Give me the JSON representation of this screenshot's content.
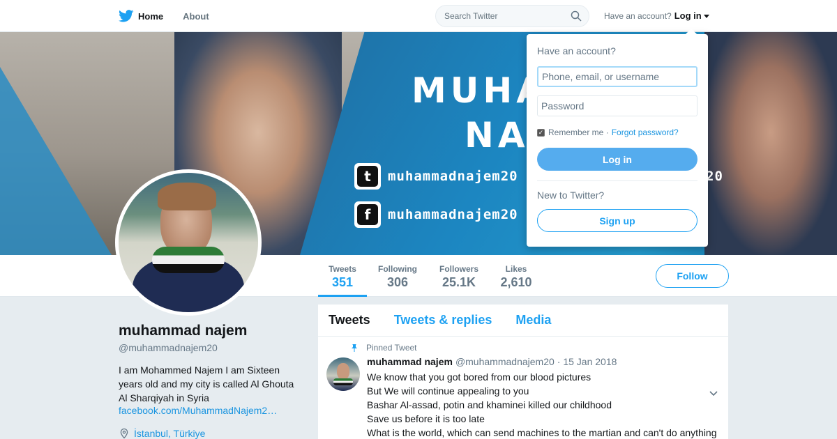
{
  "nav": {
    "home_label": "Home",
    "about_label": "About",
    "search_placeholder": "Search Twitter",
    "account_prompt": "Have an account?",
    "login_label": "Log in"
  },
  "banner": {
    "name_line1": "MUHA",
    "name_line2": "NAJ",
    "twitter_handle": "muhammadnajem20",
    "facebook_handle": "muhammadnajem20",
    "twitter_glyph": "t",
    "facebook_glyph": "f",
    "tail": "20"
  },
  "stats": [
    {
      "label": "Tweets",
      "value": "351"
    },
    {
      "label": "Following",
      "value": "306"
    },
    {
      "label": "Followers",
      "value": "25.1K"
    },
    {
      "label": "Likes",
      "value": "2,610"
    }
  ],
  "follow_label": "Follow",
  "profile": {
    "name": "muhammad najem",
    "handle": "@muhammadnajem20",
    "bio": "I am Mohammed Najem I am Sixteen years old and my city is called Al Ghouta Al Sharqiyah in Syria",
    "link": "facebook.com/MuhammadNajem2…",
    "location": "İstanbul, Türkiye"
  },
  "tabs": [
    "Tweets",
    "Tweets & replies",
    "Media"
  ],
  "tweet": {
    "pinned_label": "Pinned Tweet",
    "author": "muhammad najem",
    "handle": "@muhammadnajem20",
    "date": "· 15 Jan 2018",
    "lines": [
      "We know that you got bored from our blood pictures",
      "But We will continue appealing to you",
      "Bashar Al-assad, potin and khaminei killed our childhood",
      "Save us before it is too late",
      "What is the world, which can send machines to the martian and can't do anything"
    ]
  },
  "login_dropdown": {
    "title": "Have an account?",
    "username_placeholder": "Phone, email, or username",
    "password_placeholder": "Password",
    "remember_label": "Remember me ·",
    "forgot_label": "Forgot password?",
    "login_button": "Log in",
    "new_prompt": "New to Twitter?",
    "signup_button": "Sign up"
  },
  "colors": {
    "accent": "#1da1f2",
    "login_button": "#55acee",
    "background": "#e6ecf0"
  },
  "icons": [
    "twitter-bird-icon",
    "search-icon",
    "caret-down-icon",
    "pin-icon",
    "location-icon",
    "chevron-down-icon",
    "checkbox-checked-icon"
  ]
}
